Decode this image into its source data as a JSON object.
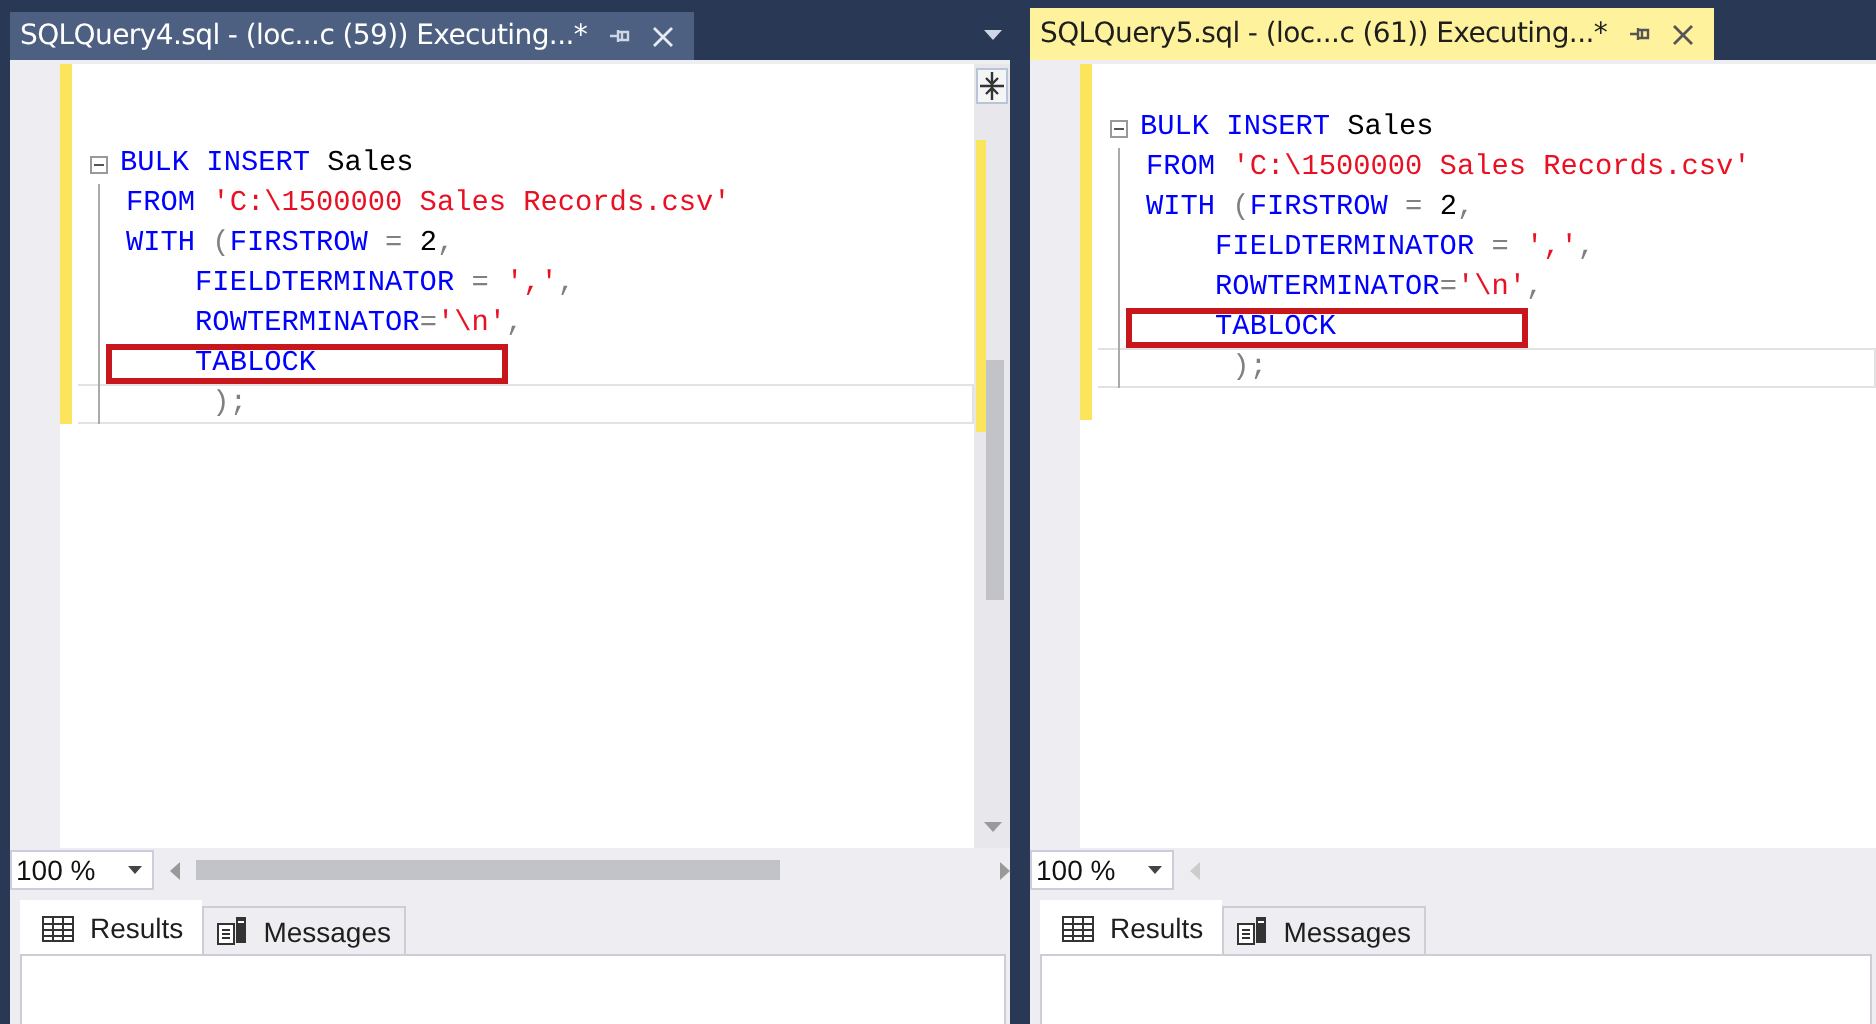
{
  "panes": [
    {
      "tab": {
        "title": "SQLQuery4.sql - (loc...c (59)) Executing...*",
        "active": false
      },
      "overflow_menu": true,
      "scrollbars": true,
      "code": [
        {
          "fold": true,
          "boxed": false,
          "current": false,
          "tokens": [
            {
              "text": "BULK INSERT",
              "kind": "keyword"
            },
            {
              "text": " Sales",
              "kind": "plain"
            }
          ]
        },
        {
          "fold": false,
          "boxed": false,
          "current": false,
          "tokens": [
            {
              "text": "FROM",
              "kind": "keyword"
            },
            {
              "text": " 'C:\\1500000 Sales Records.csv'",
              "kind": "string"
            }
          ]
        },
        {
          "fold": false,
          "boxed": false,
          "current": false,
          "tokens": [
            {
              "text": "WITH",
              "kind": "keyword"
            },
            {
              "text": " (",
              "kind": "operator"
            },
            {
              "text": "FIRSTROW",
              "kind": "keyword"
            },
            {
              "text": " =",
              "kind": "operator"
            },
            {
              "text": " 2",
              "kind": "plain"
            },
            {
              "text": ",",
              "kind": "operator"
            }
          ]
        },
        {
          "fold": false,
          "boxed": false,
          "current": false,
          "tokens": [
            {
              "text": "    FIELDTERMINATOR",
              "kind": "keyword"
            },
            {
              "text": " =",
              "kind": "operator"
            },
            {
              "text": " ','",
              "kind": "string"
            },
            {
              "text": ",",
              "kind": "operator"
            }
          ]
        },
        {
          "fold": false,
          "boxed": false,
          "current": false,
          "tokens": [
            {
              "text": "    ROWTERMINATOR",
              "kind": "keyword"
            },
            {
              "text": "=",
              "kind": "operator"
            },
            {
              "text": "'\\n'",
              "kind": "string"
            },
            {
              "text": ",",
              "kind": "operator"
            }
          ]
        },
        {
          "fold": false,
          "boxed": true,
          "current": false,
          "tokens": [
            {
              "text": "    TABLOCK",
              "kind": "keyword"
            }
          ]
        },
        {
          "fold": false,
          "boxed": false,
          "current": true,
          "tokens": [
            {
              "text": "     );",
              "kind": "operator"
            }
          ]
        }
      ],
      "zoom": "100 %",
      "result_tabs": [
        {
          "label": "Results",
          "selected": true
        },
        {
          "label": "Messages",
          "selected": false
        }
      ]
    },
    {
      "tab": {
        "title": "SQLQuery5.sql - (loc...c (61)) Executing...*",
        "active": true
      },
      "overflow_menu": false,
      "scrollbars": false,
      "code": [
        {
          "fold": true,
          "boxed": false,
          "current": false,
          "tokens": [
            {
              "text": "BULK INSERT",
              "kind": "keyword"
            },
            {
              "text": " Sales",
              "kind": "plain"
            }
          ]
        },
        {
          "fold": false,
          "boxed": false,
          "current": false,
          "tokens": [
            {
              "text": "FROM",
              "kind": "keyword"
            },
            {
              "text": " 'C:\\1500000 Sales Records.csv'",
              "kind": "string"
            }
          ]
        },
        {
          "fold": false,
          "boxed": false,
          "current": false,
          "tokens": [
            {
              "text": "WITH",
              "kind": "keyword"
            },
            {
              "text": " (",
              "kind": "operator"
            },
            {
              "text": "FIRSTROW",
              "kind": "keyword"
            },
            {
              "text": " =",
              "kind": "operator"
            },
            {
              "text": " 2",
              "kind": "plain"
            },
            {
              "text": ",",
              "kind": "operator"
            }
          ]
        },
        {
          "fold": false,
          "boxed": false,
          "current": false,
          "tokens": [
            {
              "text": "    FIELDTERMINATOR",
              "kind": "keyword"
            },
            {
              "text": " =",
              "kind": "operator"
            },
            {
              "text": " ','",
              "kind": "string"
            },
            {
              "text": ",",
              "kind": "operator"
            }
          ]
        },
        {
          "fold": false,
          "boxed": false,
          "current": false,
          "tokens": [
            {
              "text": "    ROWTERMINATOR",
              "kind": "keyword"
            },
            {
              "text": "=",
              "kind": "operator"
            },
            {
              "text": "'\\n'",
              "kind": "string"
            },
            {
              "text": ",",
              "kind": "operator"
            }
          ]
        },
        {
          "fold": false,
          "boxed": true,
          "current": false,
          "tokens": [
            {
              "text": "    TABLOCK",
              "kind": "keyword"
            }
          ]
        },
        {
          "fold": false,
          "boxed": false,
          "current": true,
          "tokens": [
            {
              "text": "     );",
              "kind": "operator"
            }
          ]
        }
      ],
      "zoom": "100 %",
      "result_tabs": [
        {
          "label": "Results",
          "selected": true
        },
        {
          "label": "Messages",
          "selected": false
        }
      ]
    }
  ]
}
